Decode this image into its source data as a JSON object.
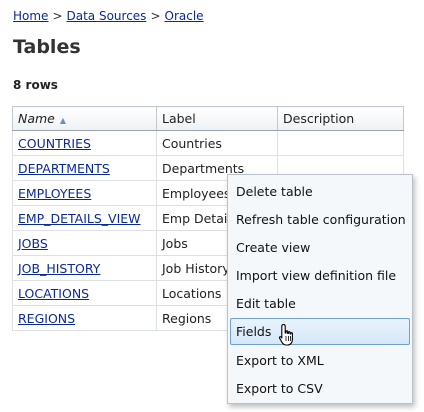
{
  "breadcrumb": [
    "Home",
    "Data Sources",
    "Oracle"
  ],
  "breadcrumb_separator": ">",
  "page_title": "Tables",
  "row_count": "8 rows",
  "table": {
    "columns": [
      "Name",
      "Label",
      "Description"
    ],
    "sort_column": "Name",
    "sort_direction": "ascending",
    "rows": [
      {
        "name": "COUNTRIES",
        "label": "Countries",
        "description": ""
      },
      {
        "name": "DEPARTMENTS",
        "label": "Departments",
        "description": ""
      },
      {
        "name": "EMPLOYEES",
        "label": "Employees",
        "description": ""
      },
      {
        "name": "EMP_DETAILS_VIEW",
        "label": "Emp Details",
        "description": ""
      },
      {
        "name": "JOBS",
        "label": "Jobs",
        "description": ""
      },
      {
        "name": "JOB_HISTORY",
        "label": "Job History",
        "description": ""
      },
      {
        "name": "LOCATIONS",
        "label": "Locations",
        "description": ""
      },
      {
        "name": "REGIONS",
        "label": "Regions",
        "description": ""
      }
    ]
  },
  "context_menu": {
    "items": [
      "Delete table",
      "Refresh table configuration",
      "Create view",
      "Import view definition file",
      "Edit table",
      "Fields",
      "Export to XML",
      "Export to CSV"
    ],
    "highlighted": "Fields"
  },
  "colors": {
    "link": "#0b2a9a",
    "menu_highlight_border": "#6fa0d6",
    "sort_arrow": "#6b8fc3"
  },
  "icons": {
    "sort": "sort-ascending-icon",
    "cursor": "hand-pointer-icon"
  }
}
